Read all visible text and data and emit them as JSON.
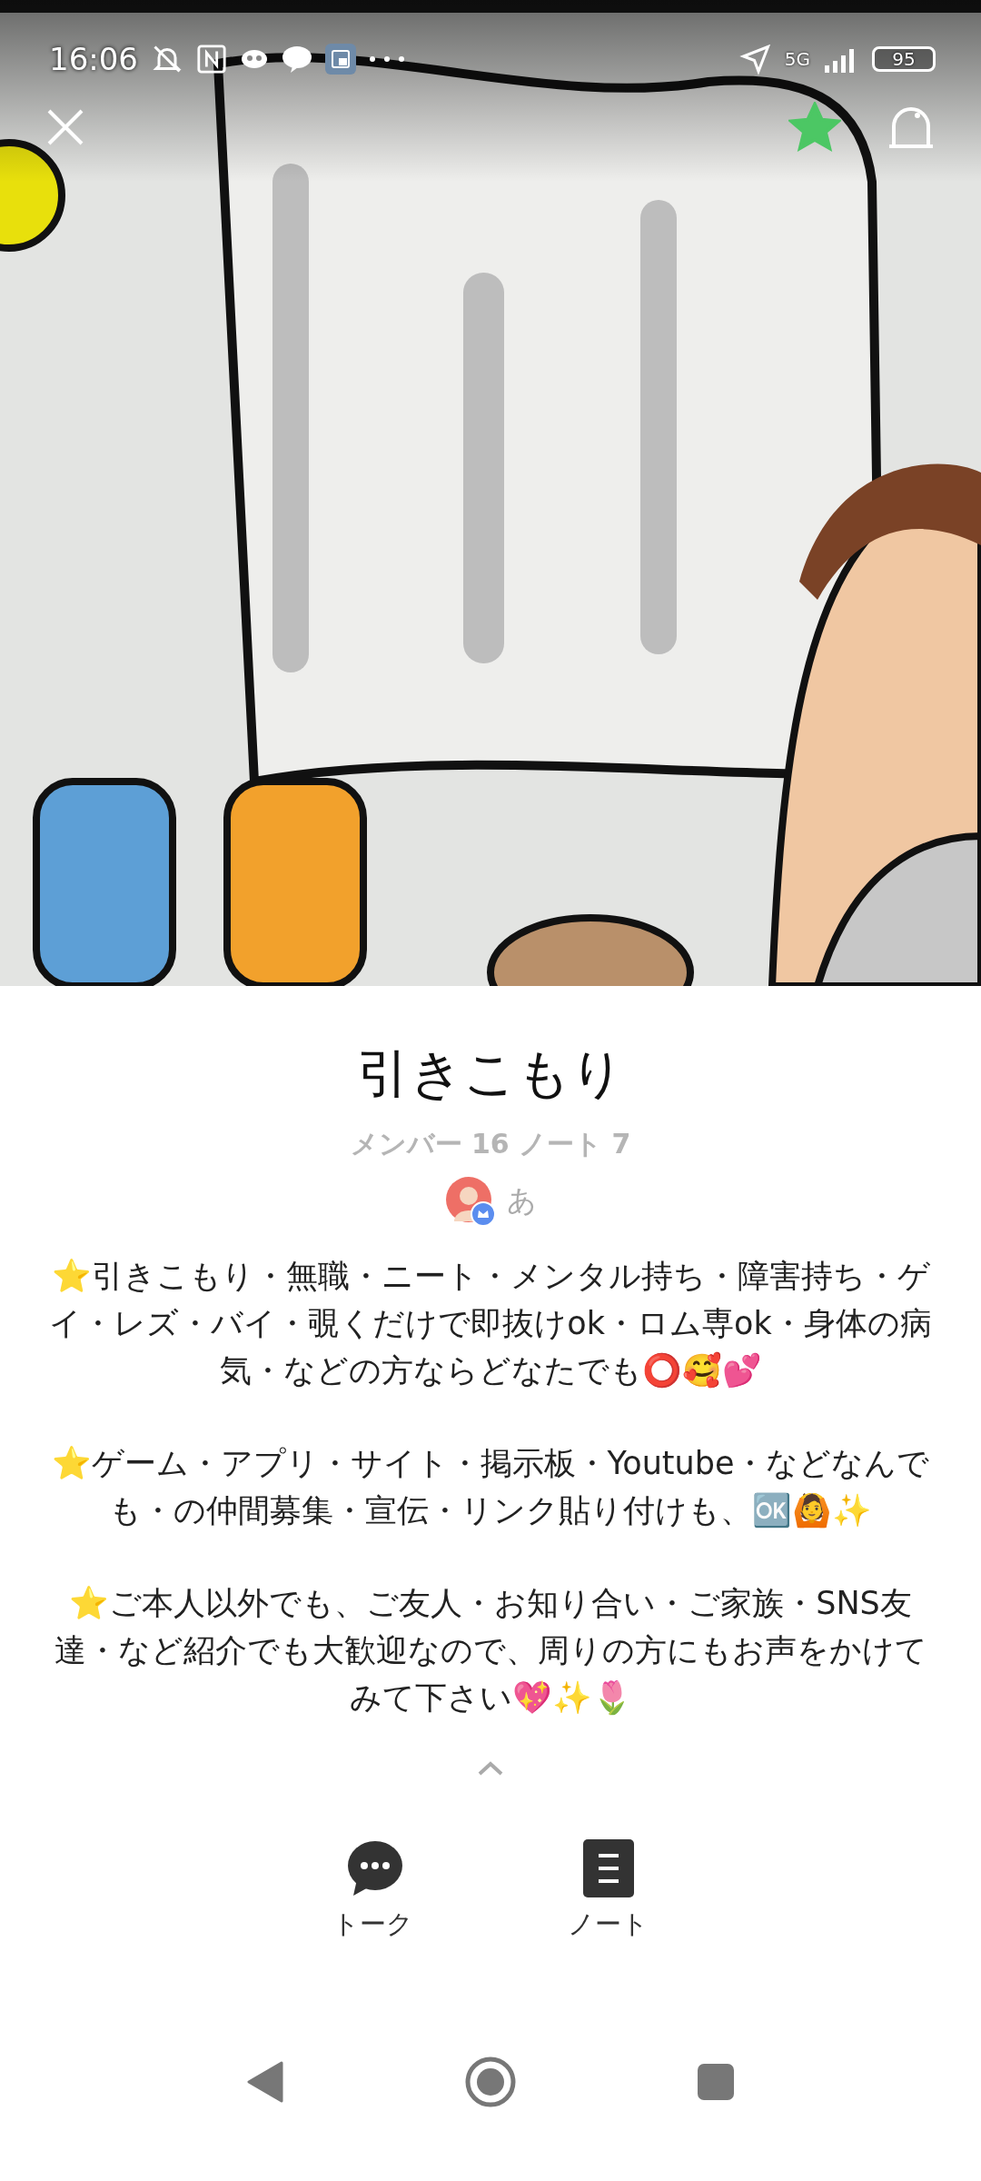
{
  "status_bar": {
    "time": "16:06",
    "network": "5G",
    "battery": "95"
  },
  "header": {
    "favorite": {
      "on": true
    }
  },
  "community": {
    "name": "引きこもり",
    "stats": "メンバー 16 ノート 7",
    "owner": "あ"
  },
  "description": [
    "⭐引きこもり・無職・ニート・メンタル持ち・障害持ち・ゲイ・レズ・バイ・覗くだけで即抜けok・ロム専ok・身体の病気・などの方ならどなたでも⭕🥰💕",
    "⭐ゲーム・アプリ・サイト・掲示板・Youtube・などなんでも・の仲間募集・宣伝・リンク貼り付けも、🆗🙆✨",
    "⭐ご本人以外でも、ご友人・お知り合い・ご家族・SNS友達・など紹介でも大歓迎なので、周りの方にもお声をかけてみて下さい💖✨🌷"
  ],
  "tabs": [
    {
      "kind": "talk",
      "label": "トーク"
    },
    {
      "kind": "note",
      "label": "ノート"
    }
  ]
}
